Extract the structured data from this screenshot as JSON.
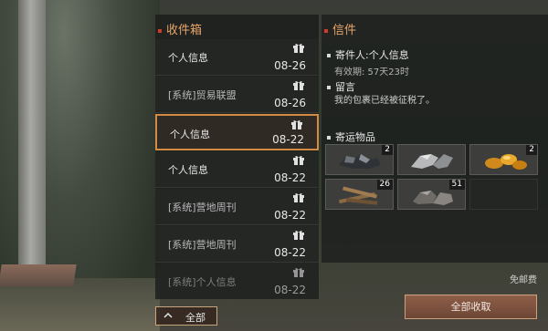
{
  "inbox": {
    "title": "收件箱",
    "mails": [
      {
        "subject": "个人信息",
        "date": "08-26",
        "system": false
      },
      {
        "subject": "[系统]贸易联盟",
        "date": "08-26",
        "system": true
      },
      {
        "subject": "个人信息",
        "date": "08-22",
        "system": false,
        "selected": true
      },
      {
        "subject": "个人信息",
        "date": "08-22",
        "system": false
      },
      {
        "subject": "[系统]营地周刊",
        "date": "08-22",
        "system": true
      },
      {
        "subject": "[系统]营地周刊",
        "date": "08-22",
        "system": true
      },
      {
        "subject": "[系统]个人信息",
        "date": "08-22",
        "system": true
      }
    ],
    "filter_label": "全部"
  },
  "letter": {
    "title": "信件",
    "sender": "寄件人:个人信息",
    "expiry": "有效期: 57天23时",
    "message_title": "留言",
    "message_body": "我的包裹已经被征税了。",
    "items_title": "寄运物品",
    "items": [
      {
        "icon": "scrap-metal-icon",
        "count": "2"
      },
      {
        "icon": "metal-ore-icon",
        "count": ""
      },
      {
        "icon": "gold-nugget-icon",
        "count": "2"
      },
      {
        "icon": "wood-logs-icon",
        "count": "26"
      },
      {
        "icon": "stone-icon",
        "count": "51"
      },
      {
        "icon": "",
        "count": ""
      }
    ]
  },
  "footer": {
    "free_mail": "免邮费",
    "claim_all": "全部收取"
  },
  "colors": {
    "accent": "#d28a44",
    "section_title": "#e6a56a",
    "claim_button": "#8e5f48"
  }
}
